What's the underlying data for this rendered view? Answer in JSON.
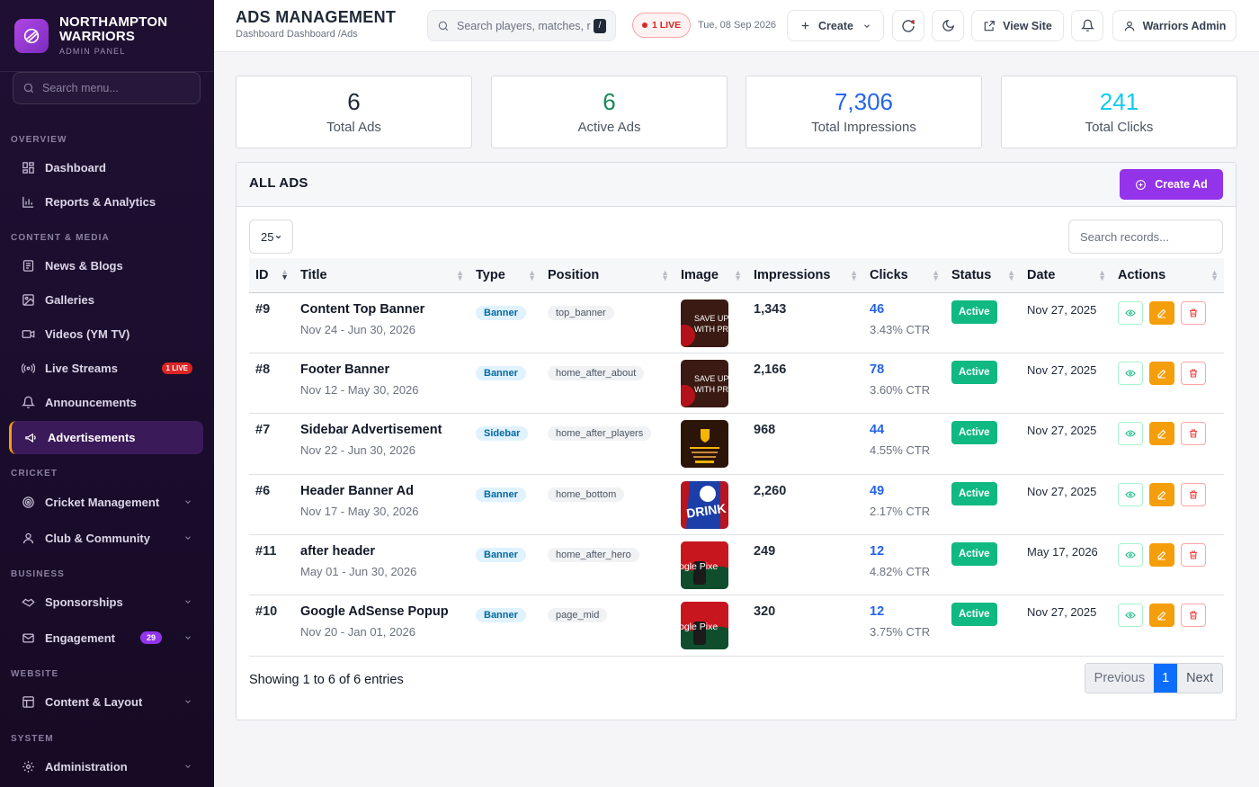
{
  "brand": {
    "name_line1": "NORTHAMPTON",
    "name_line2": "WARRIORS",
    "subtitle": "ADMIN PANEL"
  },
  "sidebar": {
    "search_placeholder": "Search menu...",
    "sections": {
      "overview": "OVERVIEW",
      "content_media": "CONTENT & MEDIA",
      "cricket": "CRICKET",
      "business": "BUSINESS",
      "website": "WEBSITE",
      "system": "SYSTEM"
    },
    "items": {
      "dashboard": "Dashboard",
      "reports": "Reports & Analytics",
      "news": "News & Blogs",
      "galleries": "Galleries",
      "videos": "Videos (YM TV)",
      "live_streams": "Live Streams",
      "live_badge": "1 LIVE",
      "announcements": "Announcements",
      "advertisements": "Advertisements",
      "cricket_management": "Cricket Management",
      "club_community": "Club & Community",
      "sponsorships": "Sponsorships",
      "engagement": "Engagement",
      "engagement_count": "29",
      "content_layout": "Content & Layout",
      "administration": "Administration"
    }
  },
  "header": {
    "title": "ADS MANAGEMENT",
    "breadcrumb": [
      "Dashboard",
      "Dashboard",
      "/Ads"
    ],
    "search_placeholder": "Search players, matches, r",
    "search_shortcut": "/",
    "live_label": "1 LIVE",
    "date": "Tue, 08 Sep 2026",
    "create_label": "Create",
    "view_site_label": "View Site",
    "user_label": "Warriors Admin"
  },
  "stats": [
    {
      "value": "6",
      "label": "Total Ads",
      "color": "#1f2937"
    },
    {
      "value": "6",
      "label": "Active Ads",
      "color": "#198754"
    },
    {
      "value": "7,306",
      "label": "Total Impressions",
      "color": "#2563eb"
    },
    {
      "value": "241",
      "label": "Total Clicks",
      "color": "#0dcaf0"
    }
  ],
  "card": {
    "title": "ALL ADS",
    "create_label": "Create Ad",
    "per_page": "25",
    "search_placeholder": "Search records..."
  },
  "table": {
    "columns": [
      "ID",
      "Title",
      "Type",
      "Position",
      "Image",
      "Impressions",
      "Clicks",
      "Status",
      "Date",
      "Actions"
    ],
    "rows": [
      {
        "id": "#9",
        "title": "Content Top Banner",
        "range": "Nov 24 - Jun 30, 2026",
        "type": "Banner",
        "position": "top_banner",
        "image": "save-up-promo",
        "impressions": "1,343",
        "clicks": "46",
        "ctr": "3.43% CTR",
        "status": "Active",
        "date": "Nov 27, 2025"
      },
      {
        "id": "#8",
        "title": "Footer Banner",
        "range": "Nov 12 - May 30, 2026",
        "type": "Banner",
        "position": "home_after_about",
        "image": "save-up-promo",
        "impressions": "2,166",
        "clicks": "78",
        "ctr": "3.60% CTR",
        "status": "Active",
        "date": "Nov 27, 2025"
      },
      {
        "id": "#7",
        "title": "Sidebar Advertisement",
        "range": "Nov 22 - Jun 30, 2026",
        "type": "Sidebar",
        "position": "home_after_players",
        "image": "ups-promo",
        "impressions": "968",
        "clicks": "44",
        "ctr": "4.55% CTR",
        "status": "Active",
        "date": "Nov 27, 2025"
      },
      {
        "id": "#6",
        "title": "Header Banner Ad",
        "range": "Nov 17 - May 30, 2026",
        "type": "Banner",
        "position": "home_bottom",
        "image": "drink-promo",
        "impressions": "2,260",
        "clicks": "49",
        "ctr": "2.17% CTR",
        "status": "Active",
        "date": "Nov 27, 2025"
      },
      {
        "id": "#11",
        "title": "after header",
        "range": "May 01 - Jun 30, 2026",
        "type": "Banner",
        "position": "home_after_hero",
        "image": "pixel-promo",
        "impressions": "249",
        "clicks": "12",
        "ctr": "4.82% CTR",
        "status": "Active",
        "date": "May 17, 2026"
      },
      {
        "id": "#10",
        "title": "Google AdSense Popup",
        "range": "Nov 20 - Jan 01, 2026",
        "type": "Banner",
        "position": "page_mid",
        "image": "pixel-promo",
        "impressions": "320",
        "clicks": "12",
        "ctr": "3.75% CTR",
        "status": "Active",
        "date": "Nov 27, 2025"
      }
    ]
  },
  "footer": {
    "showing": "Showing 1 to 6 of 6 entries",
    "previous": "Previous",
    "page": "1",
    "next": "Next"
  },
  "thumb_text": {
    "save": [
      "SAVE UP",
      "WITH PR"
    ],
    "drink": "DRINK",
    "pixel": "ogle Pixe"
  }
}
